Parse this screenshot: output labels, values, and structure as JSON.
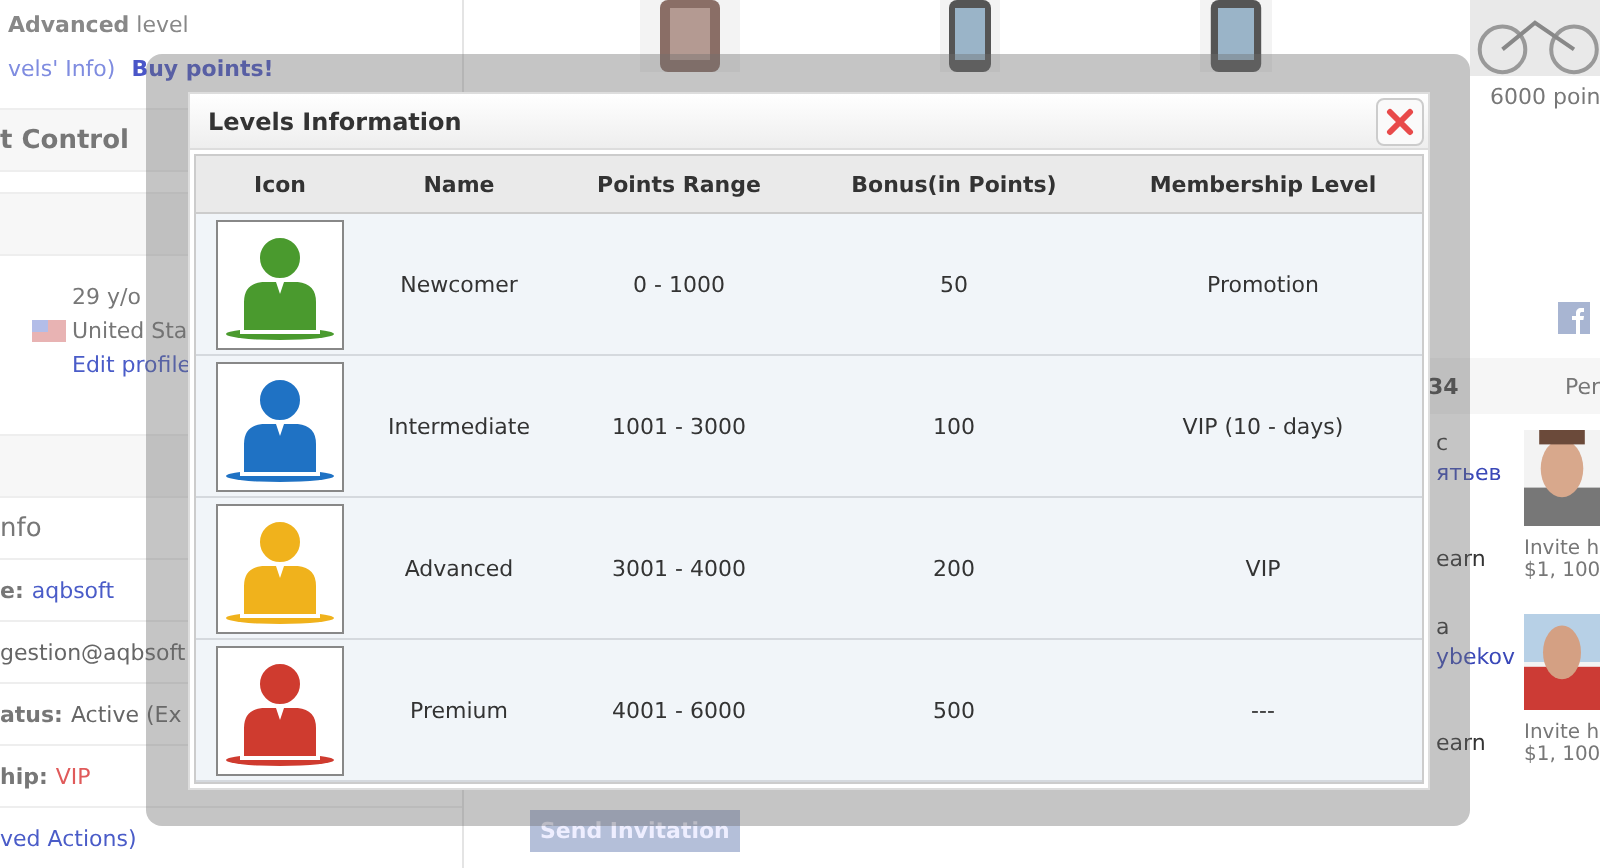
{
  "page": {
    "level_text": "**Advanced** level",
    "levels_info_link": "vels' Info)",
    "buy_points_link": "Buy points!",
    "section_title": "t Control",
    "age": "29 y/o",
    "country": "United Sta",
    "edit_profile_link": "Edit profile",
    "info_title": "nfo",
    "fields": [
      {
        "label": "e:",
        "value": "aqbsoft",
        "kind": "link"
      },
      {
        "value": "gestion@aqbsoft",
        "kind": "plain"
      },
      {
        "label": "atus:",
        "value": "Active (Ex",
        "kind": "plain"
      },
      {
        "label": "hip:",
        "value": "VIP",
        "kind": "vip"
      },
      {
        "value": "ved Actions)",
        "kind": "link"
      }
    ],
    "prize_caption": "6000 poin",
    "tab_count": "34",
    "tab_label": "Per",
    "invites": [
      {
        "fragments": [
          "c",
          "ятьев",
          "earn"
        ],
        "text": "Invite h",
        "amount": "$1, 100"
      },
      {
        "fragments": [
          "a",
          "ybekov",
          "earn"
        ],
        "text": "Invite h",
        "amount": "$1, 100"
      }
    ],
    "send_button": "Send Invitation"
  },
  "dialog": {
    "title": "Levels Information",
    "columns": [
      "Icon",
      "Name",
      "Points Range",
      "Bonus(in Points)",
      "Membership Level"
    ],
    "rows": [
      {
        "name": "Newcomer",
        "points_range": "0 - 1000",
        "bonus": "50",
        "membership": "Promotion",
        "color": "#4a9a2e"
      },
      {
        "name": "Intermediate",
        "points_range": "1001 - 3000",
        "bonus": "100",
        "membership": "VIP (10 - days)",
        "color": "#1f72c4"
      },
      {
        "name": "Advanced",
        "points_range": "3001 - 4000",
        "bonus": "200",
        "membership": "VIP",
        "color": "#f0b21c"
      },
      {
        "name": "Premium",
        "points_range": "4001 - 6000",
        "bonus": "500",
        "membership": "---",
        "color": "#cf3b2f"
      }
    ]
  }
}
